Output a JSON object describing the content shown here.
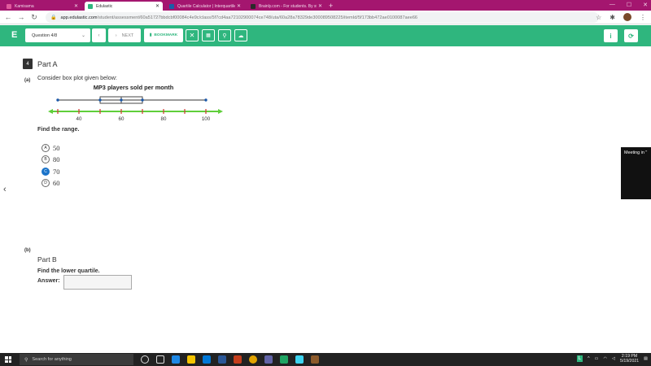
{
  "browser": {
    "tabs": [
      {
        "label": "Kamisama",
        "color": "#e05a9c",
        "active": false
      },
      {
        "label": "Edulastic",
        "color": "#2fb67e",
        "active": true
      },
      {
        "label": "Quartile Calculator | Interquartile",
        "color": "#1a5ea8",
        "active": false
      },
      {
        "label": "Brainly.com - For students. By st",
        "color": "#2a2a2a",
        "active": false
      }
    ],
    "url_host": "app.edulastic.com",
    "url_path": "/student/assessment/60a51727bbdcbf00084c4e9c/class/5f7cd4aa72102900074ce748/uta/60a28a78329de300089508225/itemId/5f173bb472ae0100087aee66"
  },
  "toolbar": {
    "logo": "E",
    "question_select": "Question 4/8",
    "next_label": "NEXT",
    "bookmark_label": "BOOKMARK"
  },
  "question": {
    "number": "4",
    "part_a_title": "Part A",
    "part_a_label": "(a)",
    "stem": "Consider box plot given below:",
    "find_range": "Find the range.",
    "choices": [
      {
        "letter": "A",
        "text": "50",
        "selected": false
      },
      {
        "letter": "B",
        "text": "80",
        "selected": false
      },
      {
        "letter": "C",
        "text": "70",
        "selected": true
      },
      {
        "letter": "D",
        "text": "60",
        "selected": false
      }
    ],
    "part_b_label": "(b)",
    "part_b_title": "Part B",
    "find_lower_quartile": "Find the lower quartile.",
    "answer_label": "Answer:",
    "answer_value": ""
  },
  "chart_data": {
    "type": "boxplot",
    "title": "MP3 players sold per month",
    "xlim": [
      30,
      105
    ],
    "ticks": [
      30,
      40,
      50,
      60,
      70,
      80,
      90,
      100
    ],
    "tick_labels": {
      "40": "40",
      "60": "60",
      "80": "80",
      "100": "100"
    },
    "min": 30,
    "q1": 50,
    "median": 60,
    "q3": 70,
    "max": 100,
    "axis_color": "#5fcf3a",
    "tick_color": "#d0433b"
  },
  "meeting_popup": "Meeting in \"",
  "taskbar": {
    "search_placeholder": "Search for anything",
    "time": "2:19 PM",
    "date": "5/19/2021"
  }
}
